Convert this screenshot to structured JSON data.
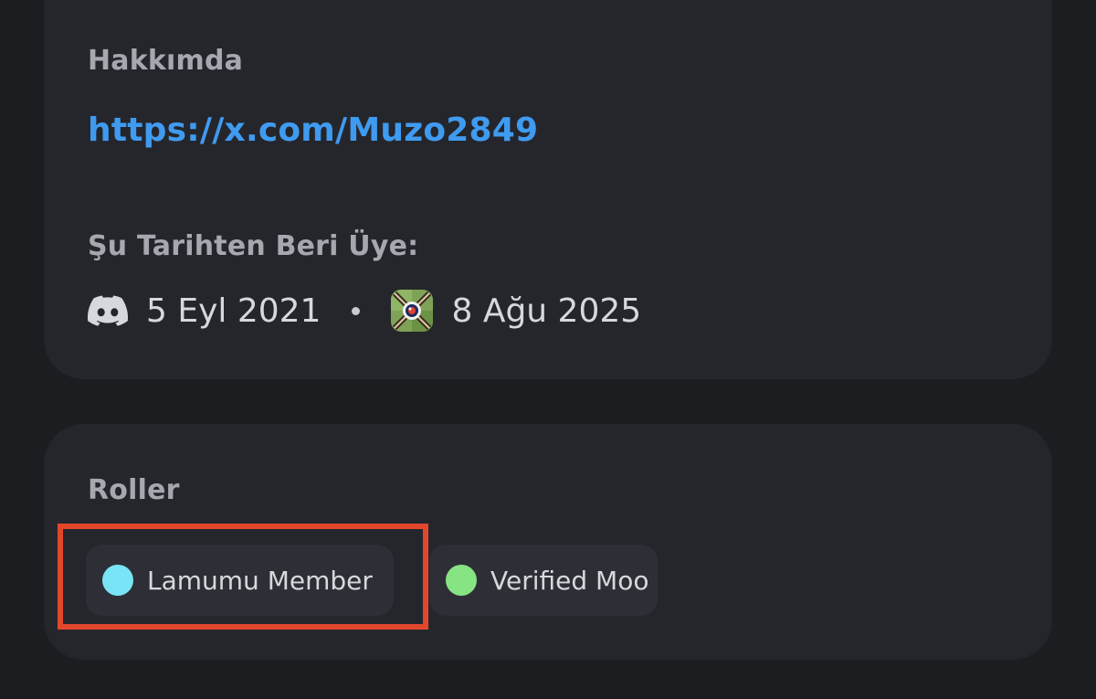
{
  "about": {
    "label": "Hakkımda",
    "link": "https://x.com/Muzo2849"
  },
  "member_since": {
    "label": "Şu Tarihten Beri Üye:",
    "discord_date": "5 Eyl 2021",
    "server_date": "8 Ağu 2025"
  },
  "roles": {
    "label": "Roller",
    "items": [
      {
        "name": "Lamumu Member",
        "color": "#79e4f6"
      },
      {
        "name": "Verified Moo",
        "color": "#86e483"
      }
    ]
  },
  "icons": {
    "discord": "discord-icon",
    "server": "server-icon",
    "separator": "dot-separator"
  },
  "colors": {
    "link": "#3f9bf0",
    "highlight": "#e3472b"
  }
}
